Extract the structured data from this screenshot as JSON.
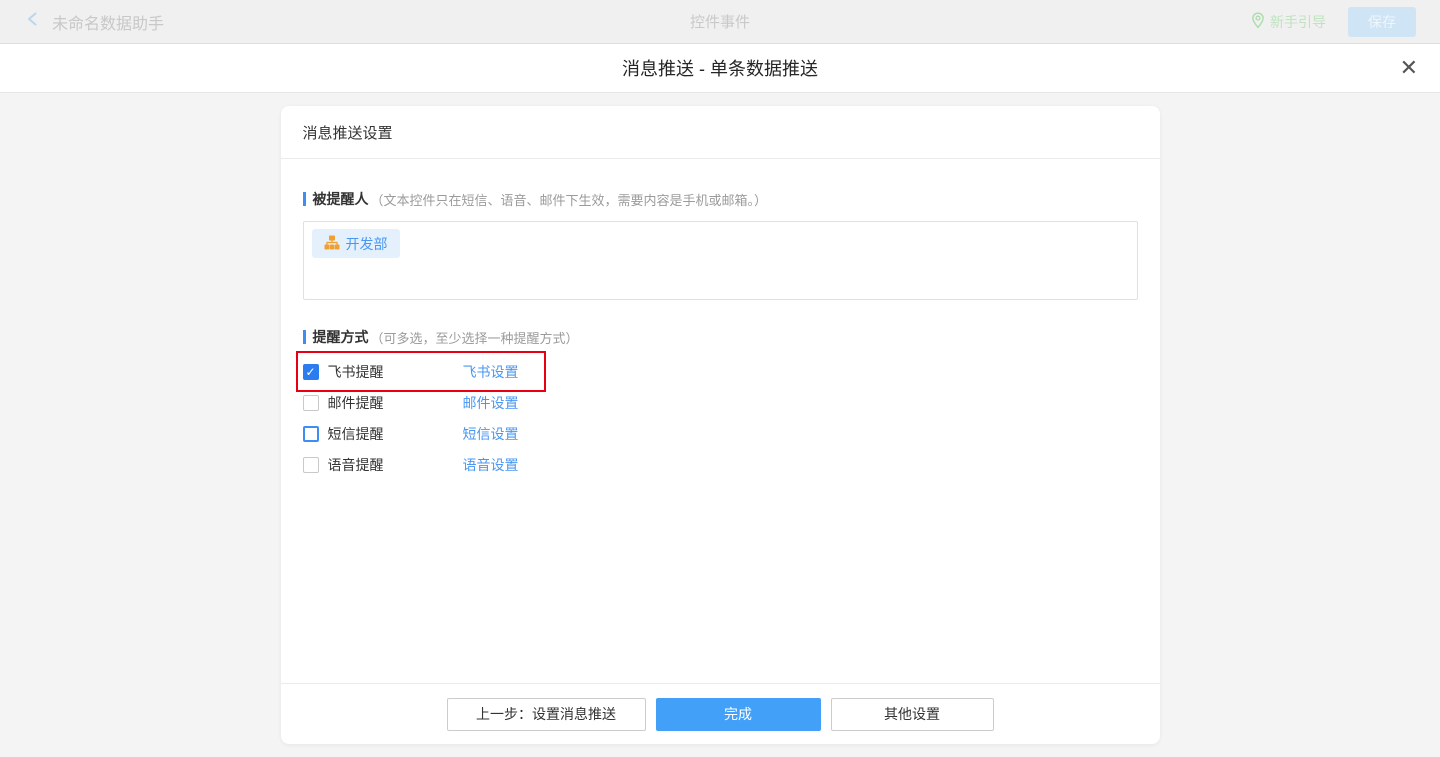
{
  "topbar": {
    "app_title": "未命名数据助手",
    "center_title": "控件事件",
    "guide_label": "新手引导",
    "save_label": "保存"
  },
  "modal": {
    "title": "消息推送 - 单条数据推送",
    "close_glyph": "✕"
  },
  "card": {
    "header": "消息推送设置",
    "recipient_section": {
      "label": "被提醒人",
      "hint": "（文本控件只在短信、语音、邮件下生效，需要内容是手机或邮箱。）",
      "tags": [
        {
          "name": "开发部"
        }
      ]
    },
    "method_section": {
      "label": "提醒方式",
      "hint": "（可多选，至少选择一种提醒方式）",
      "options": [
        {
          "label": "飞书提醒",
          "link": "飞书设置",
          "checked": true,
          "focus": false,
          "highlighted": true
        },
        {
          "label": "邮件提醒",
          "link": "邮件设置",
          "checked": false,
          "focus": false,
          "highlighted": false
        },
        {
          "label": "短信提醒",
          "link": "短信设置",
          "checked": false,
          "focus": true,
          "highlighted": false
        },
        {
          "label": "语音提醒",
          "link": "语音设置",
          "checked": false,
          "focus": false,
          "highlighted": false
        }
      ]
    },
    "footer": {
      "prev_label": "上一步：设置消息推送",
      "done_label": "完成",
      "other_label": "其他设置"
    }
  },
  "icons": {
    "back": "chevron-left-icon",
    "guide": "location-pin-icon",
    "dept": "org-chart-icon",
    "close": "close-icon",
    "checkbox_check": "check-icon"
  },
  "colors": {
    "accent_blue": "#3d8df5",
    "link_blue": "#4a97f2",
    "checkbox_checked": "#2b7cee",
    "primary_button": "#42a0f8",
    "highlight_red": "#e60012",
    "tag_bg": "#e4f1fd",
    "org_icon_orange": "#f0a032",
    "guide_green": "#bfe3bf",
    "topbar_bg": "#f0f0f0",
    "content_bg": "#f4f4f4"
  }
}
